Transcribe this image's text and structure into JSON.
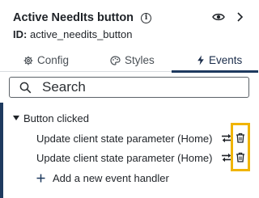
{
  "header": {
    "title": "Active NeedIts button",
    "info_icon": "i",
    "id_label": "ID:",
    "id_value": "active_needits_button"
  },
  "tabs": [
    {
      "label": "Config",
      "icon": "gear-icon",
      "active": false
    },
    {
      "label": "Styles",
      "icon": "palette-icon",
      "active": false
    },
    {
      "label": "Events",
      "icon": "lightning-icon",
      "active": true
    }
  ],
  "search": {
    "placeholder": "Search"
  },
  "events": {
    "group_label": "Button clicked",
    "handlers": [
      {
        "label": "Update client state parameter (Home)"
      },
      {
        "label": "Update client state parameter (Home)"
      }
    ],
    "add_label": "Add a new event handler"
  },
  "colors": {
    "accent": "#1e3a5f",
    "highlight": "#f0b400",
    "active_tab_underline": "#1e3a5f"
  }
}
